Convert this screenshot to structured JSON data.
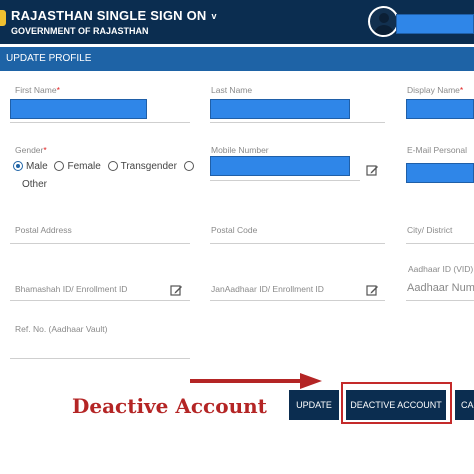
{
  "header": {
    "title": "RAJASTHAN SINGLE SIGN ON",
    "chevron": "v",
    "subtitle": "GOVERNMENT OF RAJASTHAN",
    "avatar_icon": "user-avatar-icon",
    "user_name": ""
  },
  "section": {
    "title": "UPDATE PROFILE"
  },
  "form": {
    "first_name": {
      "label": "First Name",
      "required": "*",
      "value": ""
    },
    "last_name": {
      "label": "Last Name",
      "value": ""
    },
    "display_name": {
      "label": "Display Name",
      "required": "*",
      "value": ""
    },
    "gender": {
      "label": "Gender",
      "required": "*",
      "options": [
        "Male",
        "Female",
        "Transgender",
        "Other"
      ],
      "selected": "Male"
    },
    "mobile": {
      "label": "Mobile Number",
      "value": "",
      "edit_icon": "edit-icon"
    },
    "email": {
      "label": "E-Mail Personal",
      "value": ""
    },
    "postal_address": {
      "label": "Postal Address",
      "value": ""
    },
    "postal_code": {
      "label": "Postal Code",
      "value": ""
    },
    "city_district": {
      "label": "City/ District",
      "value": ""
    },
    "bhamashah": {
      "label": "Bhamashah ID/ Enrollment ID",
      "edit_icon": "edit-icon"
    },
    "janaadhaar": {
      "label": "JanAadhaar ID/ Enrollment ID",
      "edit_icon": "edit-icon"
    },
    "aadhaar": {
      "label": "Aadhaar ID (VID)",
      "placeholder": "Aadhaar Number"
    },
    "ref_no": {
      "label": "Ref. No. (Aadhaar Vault)",
      "value": ""
    }
  },
  "annotation": {
    "text": "Deactive Account",
    "color": "#b42525"
  },
  "actions": {
    "update": "UPDATE",
    "deactivate": "DEACTIVE ACCOUNT",
    "cancel": "CA"
  },
  "colors": {
    "header_bg": "#0b2d50",
    "subbar_bg": "#1e63a6",
    "redaction": "#2f86e8",
    "highlight": "#c42a2a"
  }
}
